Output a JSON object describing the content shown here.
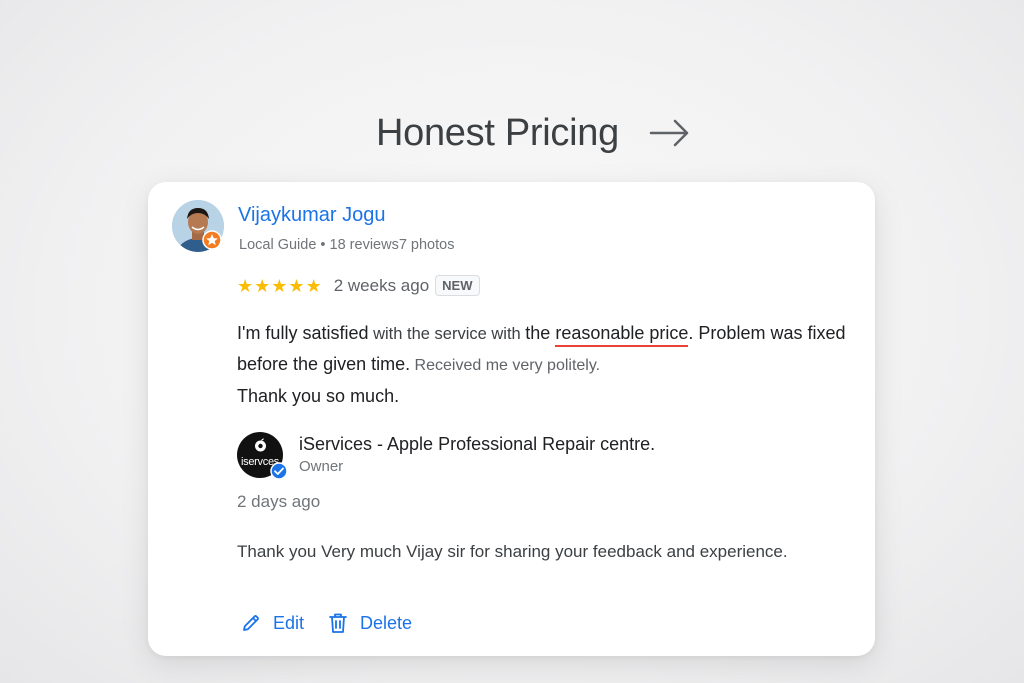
{
  "heading": {
    "title": "Honest Pricing",
    "arrow_icon": "arrow-right-icon"
  },
  "review": {
    "reviewer_name": "Vijaykumar Jogu",
    "reviewer_meta": "Local Guide • 18 reviews7 photos",
    "rating": 5,
    "stars": [
      "★",
      "★",
      "★",
      "★",
      "★"
    ],
    "date": "2 weeks ago",
    "badge": "NEW",
    "text": {
      "part1": "I'm fully satisfied",
      "part2": " with the service with ",
      "part3": "the ",
      "highlight": "reasonable price",
      "part4": ". Problem was fixed before the given time.",
      "part5": " Received me very politely.",
      "part6": "Thank you so much."
    }
  },
  "owner_reply": {
    "logo_text": "iservces",
    "business_name": "iServices",
    "business_suffix": " - Apple Professional Repair centre.",
    "role": "Owner",
    "date": "2 days ago",
    "text": "Thank you Very much Vijay sir for sharing your feedback and experience."
  },
  "actions": {
    "edit_label": "Edit",
    "delete_label": "Delete"
  },
  "colors": {
    "accent": "#1a73e8",
    "star": "#fbbc04",
    "highlight_underline": "#ea4335",
    "verified": "#1a73e8",
    "guide_badge": "#f47b20"
  }
}
